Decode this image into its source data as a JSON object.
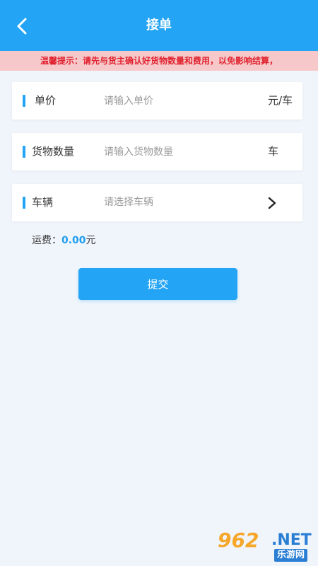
{
  "header": {
    "title": "接单",
    "back_icon": "chevron-left-icon",
    "background": "#23a4f4"
  },
  "notice": {
    "text": "温馨提示：请先与货主确认好货物数量和费用，以免影响结算，",
    "background": "#f7c8c9",
    "color": "#e0222f"
  },
  "form": {
    "unit_price": {
      "label": "单价",
      "placeholder": "请输入单价",
      "unit": "元/车"
    },
    "quantity": {
      "label": "货物数量",
      "placeholder": "请输入货物数量",
      "unit": "车"
    },
    "vehicle": {
      "label": "车辆",
      "placeholder": "请选择车辆",
      "icon": "chevron-right-icon"
    }
  },
  "freight": {
    "label": "运费：",
    "amount": "0.00",
    "currency": "元"
  },
  "submit": {
    "label": "提交"
  },
  "watermark": {
    "digits": "962",
    "domain": ".NET",
    "site_name": "乐游网"
  }
}
